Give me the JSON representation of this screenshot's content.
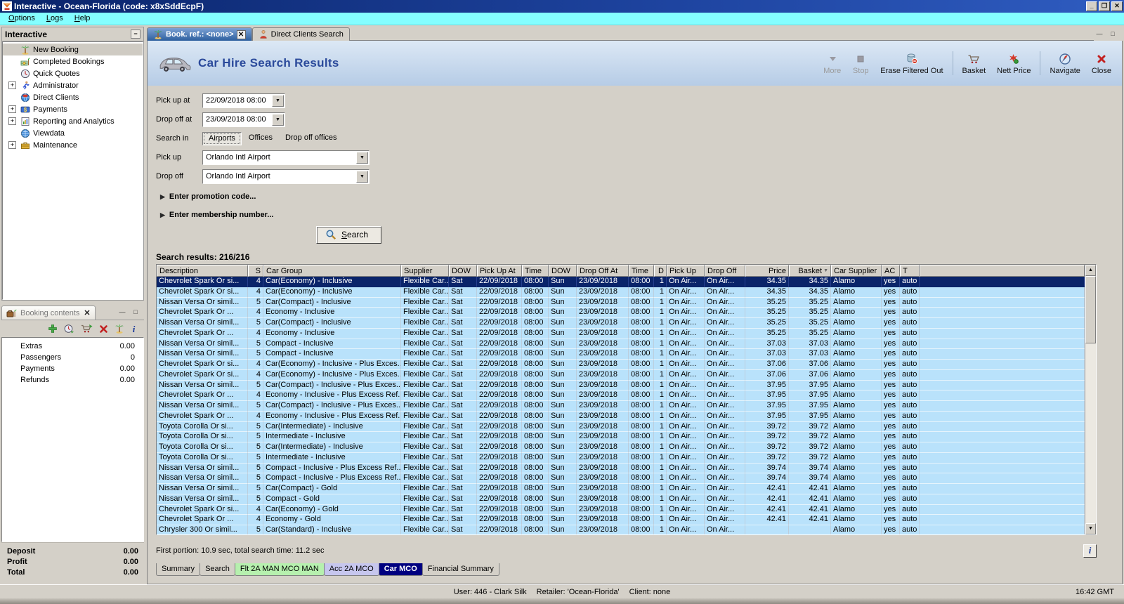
{
  "window": {
    "title": "Interactive - Ocean-Florida (code: x8xSddEcpF)",
    "buttons": [
      "minimize",
      "restore",
      "close"
    ]
  },
  "menu": {
    "items": [
      "Options",
      "Logs",
      "Help"
    ]
  },
  "sidebar": {
    "title": "Interactive",
    "items": [
      {
        "label": "New Booking",
        "icon": "palm",
        "expandable": false,
        "selected": true
      },
      {
        "label": "Completed Bookings",
        "icon": "money-palm",
        "expandable": false,
        "selected": false
      },
      {
        "label": "Quick Quotes",
        "icon": "clock",
        "expandable": false,
        "selected": false
      },
      {
        "label": "Administrator",
        "icon": "runner",
        "expandable": true,
        "selected": false
      },
      {
        "label": "Direct Clients",
        "icon": "globe-red",
        "expandable": false,
        "selected": false
      },
      {
        "label": "Payments",
        "icon": "payments",
        "expandable": true,
        "selected": false
      },
      {
        "label": "Reporting and Analytics",
        "icon": "report",
        "expandable": true,
        "selected": false
      },
      {
        "label": "Viewdata",
        "icon": "globe-blue",
        "expandable": false,
        "selected": false
      },
      {
        "label": "Maintenance",
        "icon": "toolbox",
        "expandable": true,
        "selected": false
      }
    ]
  },
  "tabs": [
    {
      "label": "Book. ref.: <none>",
      "icon": "palm",
      "active": true,
      "closable": true
    },
    {
      "label": "Direct Clients Search",
      "icon": "person",
      "active": false,
      "closable": false
    }
  ],
  "header": {
    "title": "Car Hire Search Results"
  },
  "toolbar": {
    "buttons": [
      {
        "label": "More",
        "icon": "more",
        "disabled": true,
        "group_end": false
      },
      {
        "label": "Stop",
        "icon": "stop",
        "disabled": true,
        "group_end": false
      },
      {
        "label": "Erase Filtered Out",
        "icon": "erase",
        "disabled": false,
        "group_end": true
      },
      {
        "label": "Basket",
        "icon": "cart",
        "disabled": false,
        "group_end": false
      },
      {
        "label": "Nett Price",
        "icon": "nett",
        "disabled": false,
        "group_end": true
      },
      {
        "label": "Navigate",
        "icon": "compass",
        "disabled": false,
        "group_end": false
      },
      {
        "label": "Close",
        "icon": "redx",
        "disabled": false,
        "group_end": false
      }
    ]
  },
  "form": {
    "pickup_at_label": "Pick up at",
    "pickup_at_value": "22/09/2018 08:00",
    "dropoff_at_label": "Drop off at",
    "dropoff_at_value": "23/09/2018 08:00",
    "search_in_label": "Search in",
    "search_in_tabs": [
      "Airports",
      "Offices",
      "Drop off offices"
    ],
    "search_in_active": "Airports",
    "pickup_label": "Pick up",
    "pickup_value": "Orlando Intl Airport",
    "dropoff_label": "Drop off",
    "dropoff_value": "Orlando Intl Airport",
    "promo_label": "Enter promotion code...",
    "membership_label": "Enter membership number...",
    "search_button_label": "Search"
  },
  "results": {
    "count_label": "Search results: 216/216",
    "columns": [
      "Description",
      "S",
      "Car Group",
      "Supplier",
      "DOW",
      "Pick Up At",
      "Time",
      "DOW",
      "Drop Off At",
      "Time",
      "D",
      "Pick Up",
      "Drop Off",
      "Price",
      "Basket",
      "Car Supplier",
      "AC",
      "T",
      ""
    ],
    "sort_column": "Basket",
    "shared": {
      "supplier": "Flexible Car...",
      "dow1": "Sat",
      "pickup_date": "22/09/2018",
      "pickup_time": "08:00",
      "dow2": "Sun",
      "dropoff_date": "23/09/2018",
      "dropoff_time": "08:00",
      "days": "1",
      "pickup_loc": "On Air...",
      "dropoff_loc": "On Air...",
      "car_supplier": "Alamo",
      "ac": "yes",
      "t": "auto"
    },
    "rows": [
      {
        "desc": "Chevrolet Spark Or si...",
        "s": "4",
        "group": "Car(Economy) - Inclusive",
        "price": "34.35",
        "basket": "34.35",
        "selected": true
      },
      {
        "desc": "Chevrolet Spark Or si...",
        "s": "4",
        "group": "Car(Economy) - Inclusive",
        "price": "34.35",
        "basket": "34.35",
        "selected": false
      },
      {
        "desc": "Nissan Versa Or simil...",
        "s": "5",
        "group": "Car(Compact) - Inclusive",
        "price": "35.25",
        "basket": "35.25",
        "selected": false
      },
      {
        "desc": "Chevrolet  Spark Or ...",
        "s": "4",
        "group": "Economy - Inclusive",
        "price": "35.25",
        "basket": "35.25",
        "selected": false
      },
      {
        "desc": "Nissan Versa Or simil...",
        "s": "5",
        "group": "Car(Compact) - Inclusive",
        "price": "35.25",
        "basket": "35.25",
        "selected": false
      },
      {
        "desc": "Chevrolet  Spark Or ...",
        "s": "4",
        "group": "Economy - Inclusive",
        "price": "35.25",
        "basket": "35.25",
        "selected": false
      },
      {
        "desc": "Nissan Versa Or simil...",
        "s": "5",
        "group": "Compact - Inclusive",
        "price": "37.03",
        "basket": "37.03",
        "selected": false
      },
      {
        "desc": "Nissan Versa Or simil...",
        "s": "5",
        "group": "Compact - Inclusive",
        "price": "37.03",
        "basket": "37.03",
        "selected": false
      },
      {
        "desc": "Chevrolet Spark Or si...",
        "s": "4",
        "group": "Car(Economy) - Inclusive - Plus Exces...",
        "price": "37.06",
        "basket": "37.06",
        "selected": false
      },
      {
        "desc": "Chevrolet Spark Or si...",
        "s": "4",
        "group": "Car(Economy) - Inclusive - Plus Exces...",
        "price": "37.06",
        "basket": "37.06",
        "selected": false
      },
      {
        "desc": "Nissan Versa Or simil...",
        "s": "5",
        "group": "Car(Compact) - Inclusive - Plus Exces...",
        "price": "37.95",
        "basket": "37.95",
        "selected": false
      },
      {
        "desc": "Chevrolet  Spark Or ...",
        "s": "4",
        "group": "Economy - Inclusive - Plus Excess Ref...",
        "price": "37.95",
        "basket": "37.95",
        "selected": false
      },
      {
        "desc": "Nissan Versa Or simil...",
        "s": "5",
        "group": "Car(Compact) - Inclusive - Plus Exces...",
        "price": "37.95",
        "basket": "37.95",
        "selected": false
      },
      {
        "desc": "Chevrolet  Spark Or ...",
        "s": "4",
        "group": "Economy - Inclusive - Plus Excess Ref...",
        "price": "37.95",
        "basket": "37.95",
        "selected": false
      },
      {
        "desc": "Toyota Corolla Or si...",
        "s": "5",
        "group": "Car(Intermediate) - Inclusive",
        "price": "39.72",
        "basket": "39.72",
        "selected": false
      },
      {
        "desc": "Toyota Corolla Or si...",
        "s": "5",
        "group": "Intermediate - Inclusive",
        "price": "39.72",
        "basket": "39.72",
        "selected": false
      },
      {
        "desc": "Toyota Corolla Or si...",
        "s": "5",
        "group": "Car(Intermediate) - Inclusive",
        "price": "39.72",
        "basket": "39.72",
        "selected": false
      },
      {
        "desc": "Toyota Corolla Or si...",
        "s": "5",
        "group": "Intermediate - Inclusive",
        "price": "39.72",
        "basket": "39.72",
        "selected": false
      },
      {
        "desc": "Nissan Versa Or simil...",
        "s": "5",
        "group": "Compact - Inclusive - Plus Excess Ref...",
        "price": "39.74",
        "basket": "39.74",
        "selected": false
      },
      {
        "desc": "Nissan Versa Or simil...",
        "s": "5",
        "group": "Compact - Inclusive - Plus Excess Ref...",
        "price": "39.74",
        "basket": "39.74",
        "selected": false
      },
      {
        "desc": "Nissan Versa Or simil...",
        "s": "5",
        "group": "Car(Compact) - Gold",
        "price": "42.41",
        "basket": "42.41",
        "selected": false
      },
      {
        "desc": "Nissan Versa Or simil...",
        "s": "5",
        "group": "Compact - Gold",
        "price": "42.41",
        "basket": "42.41",
        "selected": false
      },
      {
        "desc": "Chevrolet Spark Or si...",
        "s": "4",
        "group": "Car(Economy) - Gold",
        "price": "42.41",
        "basket": "42.41",
        "selected": false
      },
      {
        "desc": "Chevrolet  Spark Or ...",
        "s": "4",
        "group": "Economy - Gold",
        "price": "42.41",
        "basket": "42.41",
        "selected": false
      },
      {
        "desc": "Chrysler 300 Or simil...",
        "s": "5",
        "group": "Car(Standard) - Inclusive",
        "price": "",
        "basket": "",
        "selected": false
      }
    ],
    "footer": "First portion: 10.9 sec, total search time: 11.2 sec"
  },
  "bottom_tabs": [
    {
      "label": "Summary",
      "bg": "",
      "active": false
    },
    {
      "label": "Search",
      "bg": "",
      "active": false
    },
    {
      "label": "Flt 2A MAN MCO MAN",
      "bg": "#b6f0ae",
      "active": false
    },
    {
      "label": "Acc 2A MCO",
      "bg": "#c6c6ee",
      "active": false
    },
    {
      "label": "Car MCO",
      "bg": "",
      "active": true
    },
    {
      "label": "Financial Summary",
      "bg": "",
      "active": false
    }
  ],
  "booking_panel": {
    "title": "Booking contents",
    "toolbar_icons": [
      "add",
      "quick-quote",
      "cart-go",
      "delete",
      "palm",
      "info"
    ],
    "items": [
      {
        "label": "Extras",
        "value": "0.00"
      },
      {
        "label": "Passengers",
        "value": "0"
      },
      {
        "label": "Payments",
        "value": "0.00"
      },
      {
        "label": "Refunds",
        "value": "0.00"
      }
    ],
    "totals": [
      {
        "label": "Deposit",
        "value": "0.00"
      },
      {
        "label": "Profit",
        "value": "0.00"
      },
      {
        "label": "Total",
        "value": "0.00"
      }
    ]
  },
  "statusbar": {
    "user": "User: 446 - Clark Silk",
    "retailer": "Retailer: 'Ocean-Florida'",
    "client": "Client: none",
    "time": "16:42 GMT"
  }
}
